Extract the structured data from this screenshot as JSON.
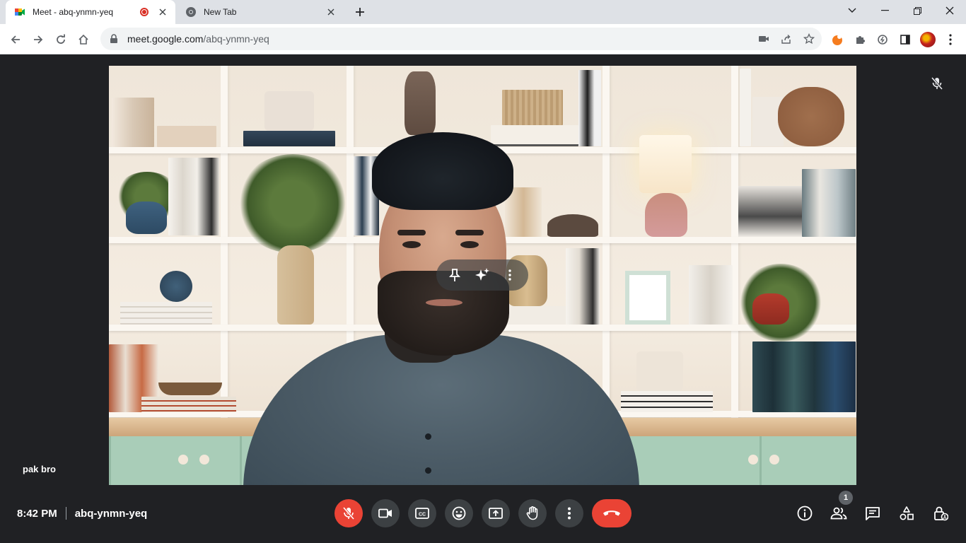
{
  "browser": {
    "tabs": [
      {
        "title": "Meet - abq-ynmn-yeq",
        "recording": true,
        "active": true
      },
      {
        "title": "New Tab",
        "active": false
      }
    ],
    "url": {
      "host": "meet.google.com",
      "path": "/abq-ynmn-yeq"
    },
    "icons": {
      "back": "arrow-left-icon",
      "forward": "arrow-right-icon",
      "reload": "reload-icon",
      "home": "home-icon",
      "camera": "camera-icon",
      "share": "share-icon",
      "bookmark": "star-icon",
      "extensions": "puzzle-icon"
    }
  },
  "meeting": {
    "participant_name": "pak bro",
    "time": "8:42 PM",
    "code": "abq-ynmn-yeq",
    "participants_count": "1",
    "mic_muted": true
  },
  "colors": {
    "accent_red": "#ea4335",
    "bar_bg": "#202124",
    "control_bg": "#3c4043"
  }
}
